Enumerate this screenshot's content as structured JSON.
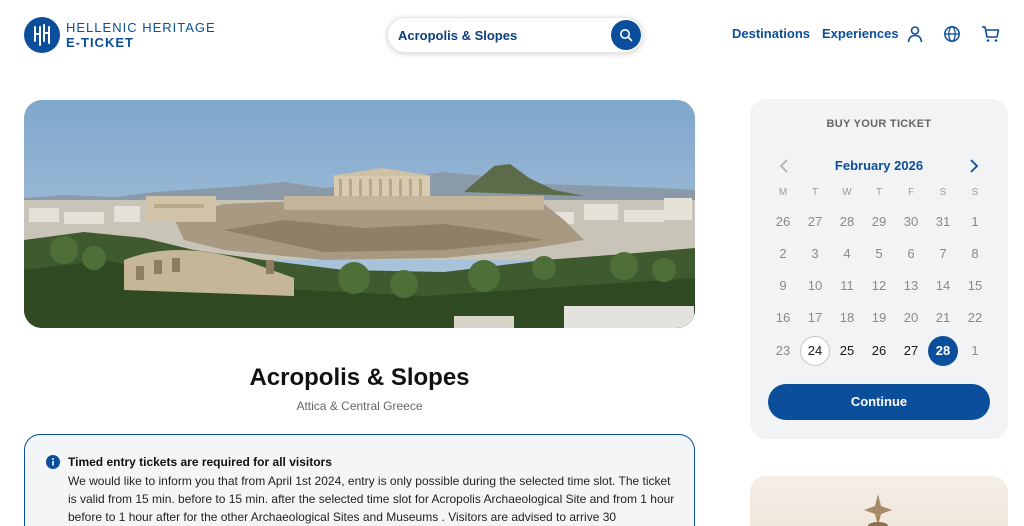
{
  "brand": {
    "line1": "HELLENIC HERITAGE",
    "line2": "E-TICKET",
    "color": "#0b4f9c"
  },
  "search": {
    "value": "Acropolis & Slopes"
  },
  "nav": {
    "destinations": "Destinations",
    "experiences": "Experiences"
  },
  "header_icons": [
    "user-icon",
    "globe-icon",
    "cart-icon"
  ],
  "site": {
    "title": "Acropolis & Slopes",
    "region": "Attica & Central Greece"
  },
  "notice": {
    "title": "Timed entry tickets are required for all visitors",
    "body": "We would like to inform you that from April 1st 2024, entry is only possible during the selected time slot. The ticket is valid from 15 min. before to 15 min. after the selected time slot for Acropolis Archaeological Site and from 1 hour before to 1 hour after for the other Archaeological Sites and Museums . Visitors are advised to arrive 30"
  },
  "ticket": {
    "heading": "BUY YOUR TICKET",
    "month": "February 2026",
    "weekdays": [
      "M",
      "T",
      "W",
      "T",
      "F",
      "S",
      "S"
    ],
    "weeks": [
      [
        "26",
        "27",
        "28",
        "29",
        "30",
        "31",
        "1"
      ],
      [
        "2",
        "3",
        "4",
        "5",
        "6",
        "7",
        "8"
      ],
      [
        "9",
        "10",
        "11",
        "12",
        "13",
        "14",
        "15"
      ],
      [
        "16",
        "17",
        "18",
        "19",
        "20",
        "21",
        "22"
      ],
      [
        "23",
        "24",
        "25",
        "26",
        "27",
        "28",
        "1"
      ]
    ],
    "today": "24",
    "selected": "28",
    "available": [
      "24",
      "25",
      "26",
      "27",
      "28"
    ],
    "continue_label": "Continue"
  }
}
